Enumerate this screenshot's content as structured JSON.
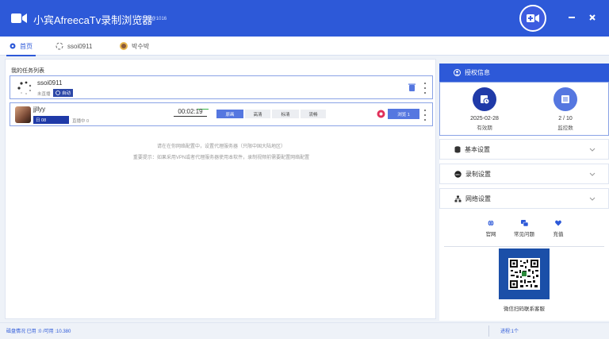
{
  "titlebar": {
    "title": "小宾AfreecaTv录制浏览器",
    "version": "v1.14@1016"
  },
  "tabs": [
    {
      "label": "首页"
    },
    {
      "label": "ssoi0911"
    },
    {
      "label": "박수박"
    }
  ],
  "task_list": {
    "title": "我的任务列表",
    "tasks": [
      {
        "name": "ssoi0911",
        "status": "未直播",
        "badge": "自动"
      },
      {
        "name": "jjllyy",
        "level": "日 08",
        "status": "直播中 0",
        "time": "00:02:19",
        "qualities": [
          "原画",
          "高清",
          "标清",
          "流畅"
        ],
        "browse": "浏览 1"
      }
    ],
    "notice1": "请在在你网络配置中，设置代理服务器（只限中国大陆地区）",
    "notice2": "重要提示：如果采用VPN或者代理服务器使用本软件，录制视频前需要配置网络配置"
  },
  "auth": {
    "header": "授权信息",
    "expiry_value": "2025-02-28",
    "expiry_label": "有效期",
    "monitor_value": "2 / 10",
    "monitor_label": "监控数"
  },
  "settings": [
    {
      "label": "基本设置"
    },
    {
      "label": "录制设置"
    },
    {
      "label": "网络设置"
    }
  ],
  "links": [
    {
      "label": "官网"
    },
    {
      "label": "常见问题"
    },
    {
      "label": "充值"
    }
  ],
  "qr_caption": "微信扫码联系客服",
  "statusbar": {
    "disk": "磁盘情况 已用 :0 /可用 :10.380",
    "process": "进程:1个"
  },
  "colors": {
    "accent": "#2d59d8",
    "dark_blue": "#1f3aa8",
    "button_blue": "#5577e0"
  }
}
